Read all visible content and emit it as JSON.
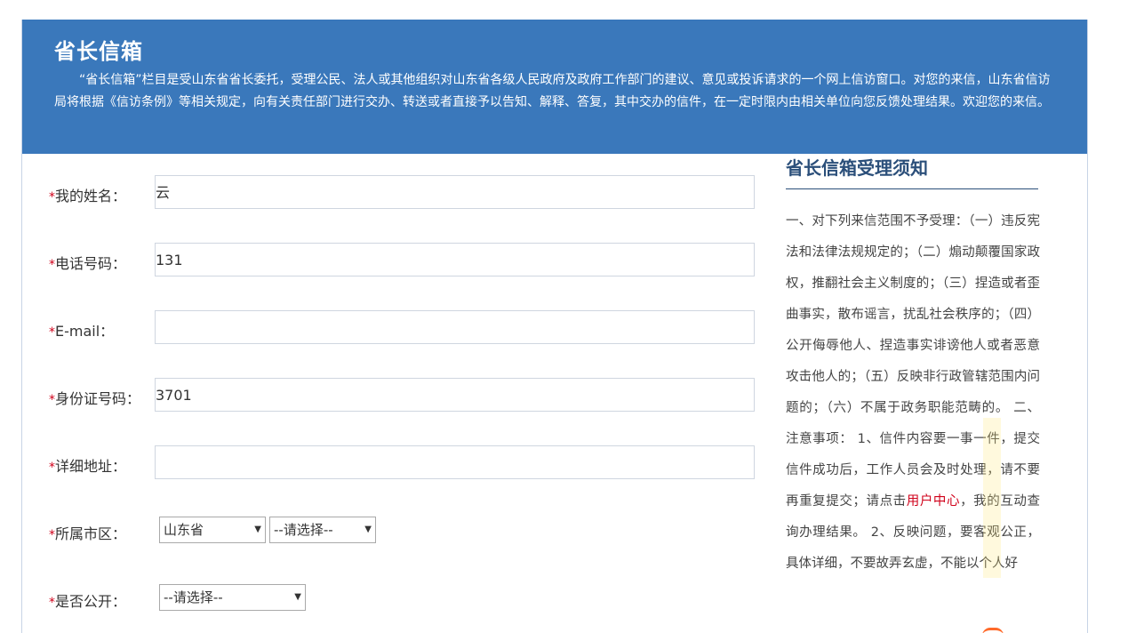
{
  "banner": {
    "title": "省长信箱",
    "description": "“省长信箱”栏目是受山东省省长委托，受理公民、法人或其他组织对山东省各级人民政府及政府工作部门的建议、意见或投诉请求的一个网上信访窗口。对您的来信，山东省信访局将根据《信访条例》等相关规定，向有关责任部门进行交办、转送或者直接予以告知、解释、答复，其中交办的信件，在一定时限内由相关单位向您反馈处理结果。欢迎您的来信。"
  },
  "form": {
    "required_mark": "*",
    "name": {
      "label": "我的姓名：",
      "value": "  云"
    },
    "phone": {
      "label": "电话号码：",
      "value": "131"
    },
    "email": {
      "label": "E-mail：",
      "value": ""
    },
    "id_number": {
      "label": "身份证号码：",
      "value": "3701"
    },
    "address": {
      "label": "详细地址：",
      "value": ""
    },
    "region": {
      "label": "所属市区：",
      "province": "山东省",
      "city": "--请选择--"
    },
    "public": {
      "label": "是否公开：",
      "value": "--请选择--"
    }
  },
  "notice": {
    "title": "省长信箱受理须知",
    "body_before": "一、对下列来信范围不予受理：（一）违反宪法和法律法规规定的；（二）煽动颠覆国家政权，推翻社会主义制度的；（三）捏造或者歪曲事实，散布谣言，扰乱社会秩序的；（四）公开侮辱他人、捏造事实诽谤他人或者恶意攻击他人的；（五）反映非行政管辖范围内问题的；（六）不属于政务职能范畴的。 二、注意事项： 1、信件内容要一事一件，提交信件成功后，工作人员会及时处理，请不要再重复提交；请点击",
    "link": "用户中心",
    "body_after": "，我的互动查询办理结果。 2、反映问题，要客观公正，具体详细，不要故弄玄虚，不能以个人好"
  },
  "colors": {
    "banner_bg": "#3a78bb",
    "required": "#d0021b",
    "notice_title": "#2b4f7a"
  }
}
